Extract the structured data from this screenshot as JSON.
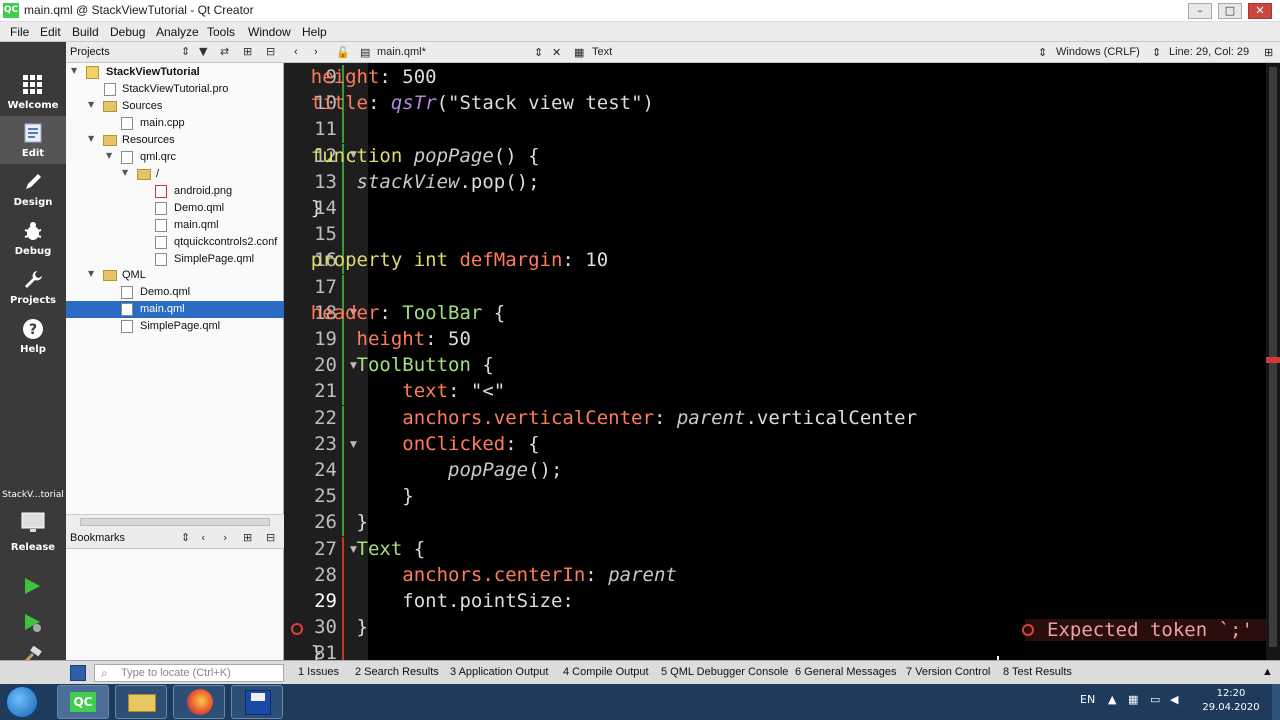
{
  "window": {
    "title": "main.qml @ StackViewTutorial - Qt Creator",
    "app_icon": "QC",
    "minimize": "–",
    "maximize": "□",
    "close": "✕"
  },
  "menu": [
    "File",
    "Edit",
    "Build",
    "Debug",
    "Analyze",
    "Tools",
    "Window",
    "Help"
  ],
  "modes": [
    {
      "label": "Welcome",
      "icon": "grid-icon"
    },
    {
      "label": "Edit",
      "icon": "edit-document-icon"
    },
    {
      "label": "Design",
      "icon": "pencil-icon"
    },
    {
      "label": "Debug",
      "icon": "bug-icon"
    },
    {
      "label": "Projects",
      "icon": "wrench-icon"
    },
    {
      "label": "Help",
      "icon": "question-icon"
    }
  ],
  "kit": {
    "name": "StackV...torial",
    "config": "Release"
  },
  "projects_panel": {
    "title": "Projects",
    "tree": [
      {
        "label": "StackViewTutorial",
        "depth": 0,
        "kind": "project",
        "expanded": true,
        "bold": true
      },
      {
        "label": "StackViewTutorial.pro",
        "depth": 1,
        "kind": "file"
      },
      {
        "label": "Sources",
        "depth": 1,
        "kind": "folder",
        "expanded": true
      },
      {
        "label": "main.cpp",
        "depth": 2,
        "kind": "file"
      },
      {
        "label": "Resources",
        "depth": 1,
        "kind": "folder",
        "expanded": true
      },
      {
        "label": "qml.qrc",
        "depth": 2,
        "kind": "file",
        "expanded": true
      },
      {
        "label": "/",
        "depth": 3,
        "kind": "folder",
        "expanded": true
      },
      {
        "label": "android.png",
        "depth": 4,
        "kind": "file"
      },
      {
        "label": "Demo.qml",
        "depth": 4,
        "kind": "file"
      },
      {
        "label": "main.qml",
        "depth": 4,
        "kind": "file"
      },
      {
        "label": "qtquickcontrols2.conf",
        "depth": 4,
        "kind": "file"
      },
      {
        "label": "SimplePage.qml",
        "depth": 4,
        "kind": "file"
      },
      {
        "label": "QML",
        "depth": 1,
        "kind": "folder",
        "expanded": true
      },
      {
        "label": "Demo.qml",
        "depth": 2,
        "kind": "file"
      },
      {
        "label": "main.qml",
        "depth": 2,
        "kind": "file",
        "selected": true
      },
      {
        "label": "SimplePage.qml",
        "depth": 2,
        "kind": "file"
      }
    ]
  },
  "bookmarks_panel": {
    "title": "Bookmarks"
  },
  "editor_toolbar": {
    "file": "main.qml*",
    "symbol": "Text",
    "line_endings": "Windows (CRLF)",
    "position": "Line: 29, Col: 29"
  },
  "editor": {
    "first_line": 9,
    "current_line": 29,
    "lines": [
      [
        {
          "c": "p",
          "t": "    height"
        },
        {
          "c": "pl",
          "t": ": 500"
        }
      ],
      [
        {
          "c": "p",
          "t": "    title"
        },
        {
          "c": "pl",
          "t": ": "
        },
        {
          "c": "q",
          "t": "qsTr"
        },
        {
          "c": "pl",
          "t": "(\"Stack view test\")"
        }
      ],
      [
        {
          "c": "pl",
          "t": ""
        }
      ],
      [
        {
          "c": "x",
          "t": "    function "
        },
        {
          "c": "i",
          "t": "popPage"
        },
        {
          "c": "pl",
          "t": "() {"
        }
      ],
      [
        {
          "c": "i",
          "t": "        stackView"
        },
        {
          "c": "pl",
          "t": ".pop();"
        }
      ],
      [
        {
          "c": "pl",
          "t": "    }"
        }
      ],
      [
        {
          "c": "pl",
          "t": ""
        }
      ],
      [
        {
          "c": "x",
          "t": "    property int "
        },
        {
          "c": "p",
          "t": "defMargin"
        },
        {
          "c": "pl",
          "t": ": 10"
        }
      ],
      [
        {
          "c": "pl",
          "t": ""
        }
      ],
      [
        {
          "c": "p",
          "t": "    header"
        },
        {
          "c": "pl",
          "t": ": "
        },
        {
          "c": "t",
          "t": "ToolBar"
        },
        {
          "c": "pl",
          "t": " {"
        }
      ],
      [
        {
          "c": "p",
          "t": "        height"
        },
        {
          "c": "pl",
          "t": ": 50"
        }
      ],
      [
        {
          "c": "t",
          "t": "        ToolButton"
        },
        {
          "c": "pl",
          "t": " {"
        }
      ],
      [
        {
          "c": "p",
          "t": "            text"
        },
        {
          "c": "pl",
          "t": ": \"<\""
        }
      ],
      [
        {
          "c": "p",
          "t": "            anchors.verticalCenter"
        },
        {
          "c": "pl",
          "t": ": "
        },
        {
          "c": "i",
          "t": "parent"
        },
        {
          "c": "pl",
          "t": ".verticalCenter"
        }
      ],
      [
        {
          "c": "p",
          "t": "            onClicked"
        },
        {
          "c": "pl",
          "t": ": {"
        }
      ],
      [
        {
          "c": "i",
          "t": "                popPage"
        },
        {
          "c": "pl",
          "t": "();"
        }
      ],
      [
        {
          "c": "pl",
          "t": "            }"
        }
      ],
      [
        {
          "c": "pl",
          "t": "        }"
        }
      ],
      [
        {
          "c": "t",
          "t": "        Text"
        },
        {
          "c": "pl",
          "t": " {"
        }
      ],
      [
        {
          "c": "p",
          "t": "            anchors.centerIn"
        },
        {
          "c": "pl",
          "t": ": "
        },
        {
          "c": "i",
          "t": "parent"
        }
      ],
      [
        {
          "c": "pl",
          "t": "            font.pointSize: "
        }
      ],
      [
        {
          "c": "pl",
          "t": "        }"
        }
      ],
      [
        {
          "c": "pl",
          "t": "    }"
        }
      ]
    ],
    "error": "Expected token `;'"
  },
  "status": {
    "locate_placeholder": "Type to locate (Ctrl+K)",
    "tabs": [
      "1  Issues",
      "2  Search Results",
      "3  Application Output",
      "4  Compile Output",
      "5  QML Debugger Console",
      "6  General Messages",
      "7  Version Control",
      "8  Test Results"
    ]
  },
  "taskbar": {
    "lang": "EN",
    "time": "12:20",
    "date": "29.04.2020"
  },
  "colors": {
    "accent": "#2a6cc4",
    "mode_bar": "#3a3a3a",
    "editor_bg": "#000000",
    "error": "#e0403a"
  }
}
